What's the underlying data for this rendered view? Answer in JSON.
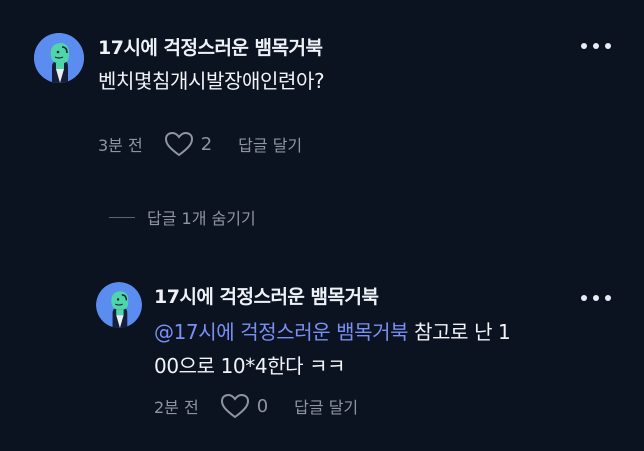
{
  "comments": [
    {
      "author": "17시에 걱정스러운 뱀목거북",
      "text": "벤치몇침개시발장애인련아?",
      "time": "3분 전",
      "likes": "2",
      "reply_label": "답글 달기"
    }
  ],
  "replies_toggle": "답글 1개 숨기기",
  "reply": {
    "author": "17시에 걱정스러운 뱀목거북",
    "mention": "@17시에 걱정스러운 뱀목거북",
    "text_line1": " 참고로 난 1",
    "text_line2": "00으로 10*4한다 ㅋㅋ",
    "time": "2분 전",
    "likes": "0",
    "reply_label": "답글 달기"
  },
  "icons": {
    "more": "more-horizontal-icon",
    "heart": "heart-outline-icon"
  },
  "colors": {
    "background": "#0b1220",
    "mention": "#7a8ff4",
    "meta": "#8e94a2",
    "avatar_bg": "#5b8cf0",
    "avatar_figure": "#4fd6a8"
  }
}
